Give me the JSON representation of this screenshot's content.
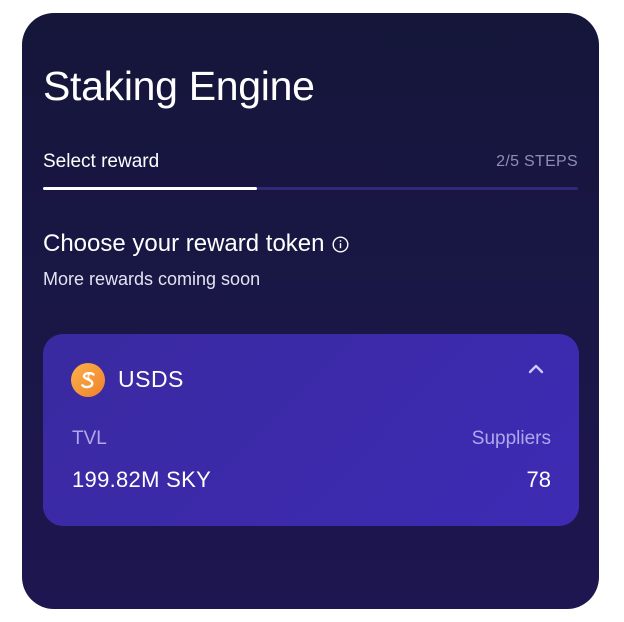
{
  "header": {
    "title": "Staking Engine"
  },
  "steps": {
    "current_label": "Select reward",
    "count_text": "2/5 STEPS",
    "progress_fraction": 0.4
  },
  "section": {
    "heading": "Choose your reward token",
    "subtext": "More rewards coming soon",
    "info_icon": "info-icon"
  },
  "token_card": {
    "name": "USDS",
    "logo_icon": "usds-logo-icon",
    "expanded_icon": "chevron-up-icon",
    "tvl_label": "TVL",
    "tvl_value": "199.82M SKY",
    "suppliers_label": "Suppliers",
    "suppliers_value": "78"
  },
  "colors": {
    "panel_background": "#15163a",
    "card_background": "#3a2aa0",
    "progress_track": "#2f2a78",
    "label_purple": "#b0a8ee",
    "logo_orange": "#f6a03a"
  }
}
